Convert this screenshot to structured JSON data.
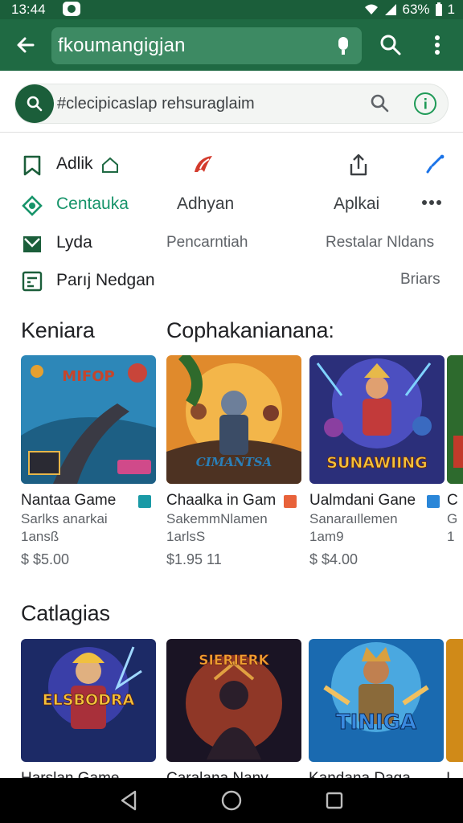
{
  "status_bar": {
    "time": "13:44",
    "battery": "63%",
    "extra": "1"
  },
  "app_bar": {
    "search_text": "fkoumangigjan"
  },
  "sub_search": {
    "text": "#clecipicaslap rehsuraglaim"
  },
  "menu": [
    {
      "left": {
        "label": "Adlik",
        "icon": "bookmark-icon"
      },
      "mid": {
        "label": "",
        "icon": "app-logo-icon"
      },
      "right": {
        "label": "",
        "icon": "share-icon"
      },
      "far": {
        "icon": "edit-icon"
      }
    },
    {
      "left": {
        "label": "Centauka",
        "icon": "category-icon"
      },
      "mid": {
        "label": "Adhyan"
      },
      "right": {
        "label": "Aplkai"
      },
      "far": {
        "icon": "more-horiz-icon"
      }
    },
    {
      "left": {
        "label": "Lyda",
        "icon": "mail-icon"
      },
      "mid": {
        "label": "Pencarntiah"
      },
      "right": {
        "label": "Restalar Nldans"
      }
    },
    {
      "left": {
        "label": "Parıj Nedgan",
        "icon": "checklist-icon"
      },
      "right": {
        "label": "Briars"
      }
    }
  ],
  "section1": {
    "title_left": "Keniara",
    "title_right": "Cophakanianana:",
    "cards": [
      {
        "name": "Nantaa Game",
        "sub": "Sarlks anarkai",
        "meta": "1ansß",
        "price": "$ $5.00",
        "badge_color": "#1a9aa6"
      },
      {
        "name": "Chaalka in Gam",
        "sub": "SakemmNlamen",
        "meta": "1arlsS",
        "price": "$1.95 11",
        "badge_color": "#e8623a"
      },
      {
        "name": "Ualmdani Gane",
        "sub": "Sanaraıllemen",
        "meta": "1am9",
        "price": "$ $4.00",
        "badge_color": "#2a86d8"
      },
      {
        "name": "C",
        "sub": "G",
        "meta": "1",
        "price": "",
        "badge_color": ""
      }
    ]
  },
  "section2": {
    "title": "Catlagias",
    "cards": [
      {
        "name": "Harslan Game",
        "art": "ELSBODRA"
      },
      {
        "name": "Caralana Nanv",
        "art": "SIERIERK"
      },
      {
        "name": "Kandana Daga",
        "art": "TINIGA"
      },
      {
        "name": "I",
        "art": ""
      }
    ]
  },
  "art_text": {
    "c1": "MIFOP",
    "c2": "CIMANTSA",
    "c3": "SUNAWIING"
  },
  "colors": {
    "app_bar": "#1f6a43",
    "status_bar": "#1b5e3a",
    "accent": "#17946a"
  }
}
